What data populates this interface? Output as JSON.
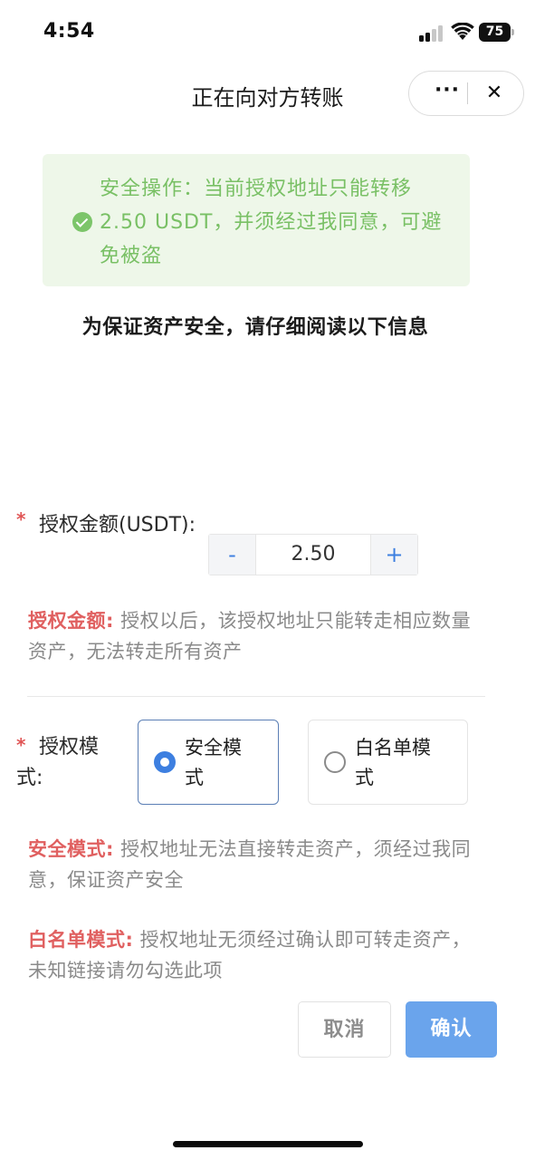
{
  "status_bar": {
    "time": "4:54",
    "battery_level": "75",
    "icons": [
      "signal-icon",
      "wifi-icon",
      "battery-icon"
    ]
  },
  "nav": {
    "title": "正在向对方转账",
    "more_label": "···",
    "close_label": "✕"
  },
  "notice": {
    "icon": "check-circle-icon",
    "text": "安全操作：当前授权地址只能转移2.50 USDT，并须经过我同意，可避免被盗",
    "color": "#79c065"
  },
  "read_notice": "为保证资产安全，请仔细阅读以下信息",
  "amount": {
    "required_mark": "*",
    "label": "授权金额(USDT):",
    "decrement_label": "-",
    "value": "2.50",
    "increment_label": "+",
    "desc_title": "授权金额:",
    "desc_text": " 授权以后，该授权地址只能转走相应数量资产，无法转走所有资产"
  },
  "mode": {
    "required_mark": "*",
    "label": "授权模式:",
    "options": [
      {
        "label": "安全模式",
        "selected": true
      },
      {
        "label": "白名单模式",
        "selected": false
      }
    ],
    "safe_desc_title": "安全模式:",
    "safe_desc_text": " 授权地址无法直接转走资产，须经过我同意，保证资产安全",
    "white_desc_title": "白名单模式:",
    "white_desc_text": " 授权地址无须经过确认即可转走资产，未知链接请勿勾选此项"
  },
  "actions": {
    "cancel_label": "取消",
    "confirm_label": "确认"
  },
  "colors": {
    "accent": "#3d7fe0",
    "confirm_button": "#6aa4ec",
    "highlight_red": "#e06060",
    "notice_bg": "#eef7e9"
  }
}
